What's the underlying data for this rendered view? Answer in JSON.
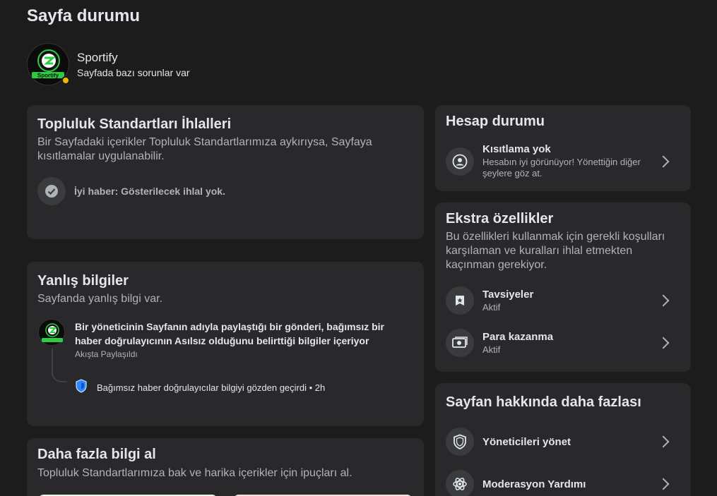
{
  "header": {
    "title": "Sayfa durumu",
    "page_name": "Sportify",
    "page_status": "Sayfada bazı sorunlar var"
  },
  "community_standards": {
    "title": "Topluluk Standartları İhlalleri",
    "description": "Bir Sayfadaki içerikler Topluluk Standartlarımıza aykırıysa, Sayfaya kısıtlamalar uygulanabilir.",
    "status_text": "İyi haber: Gösterilecek ihlal yok."
  },
  "misinformation": {
    "title": "Yanlış bilgiler",
    "description": "Sayfanda yanlış bilgi var.",
    "post_text": "Bir yöneticinin Sayfanın adıyla paylaştığı bir gönderi, bağımsız bir haber doğrulayıcının Asılsız olduğunu belirttiği bilgiler içeriyor",
    "post_meta": "Akışta Paylaşıldı",
    "review_text": "Bağımsız haber doğrulayıcılar bilgiyi gözden geçirdi • 2h"
  },
  "learn_more": {
    "title": "Daha fazla bilgi al",
    "description": "Topluluk Standartlarımıza bak ve harika içerikler için ipuçları al."
  },
  "account_status": {
    "title": "Hesap durumu",
    "item_title": "Kısıtlama yok",
    "item_sub": "Hesabın iyi görünüyor! Yönettiğin diğer şeylere göz at."
  },
  "extra_features": {
    "title": "Ekstra özellikler",
    "description": "Bu özellikleri kullanmak için gerekli koşulları karşılaman ve kuralları ihlal etmekten kaçınman gerekiyor.",
    "items": [
      {
        "title": "Tavsiyeler",
        "sub": "Aktif",
        "icon": "recommendation-badge-icon"
      },
      {
        "title": "Para kazanma",
        "sub": "Aktif",
        "icon": "money-icon"
      }
    ]
  },
  "more_about": {
    "title": "Sayfan hakkında daha fazlası",
    "items": [
      {
        "title": "Yöneticileri yönet",
        "icon": "shield-icon"
      },
      {
        "title": "Moderasyon Yardımı",
        "icon": "moderation-icon"
      }
    ]
  },
  "colors": {
    "background": "#1c1c1d",
    "card": "#29292b",
    "accent_blue": "#2d88ff",
    "badge_yellow": "#f5b800",
    "logo_green": "#2ecc40"
  }
}
